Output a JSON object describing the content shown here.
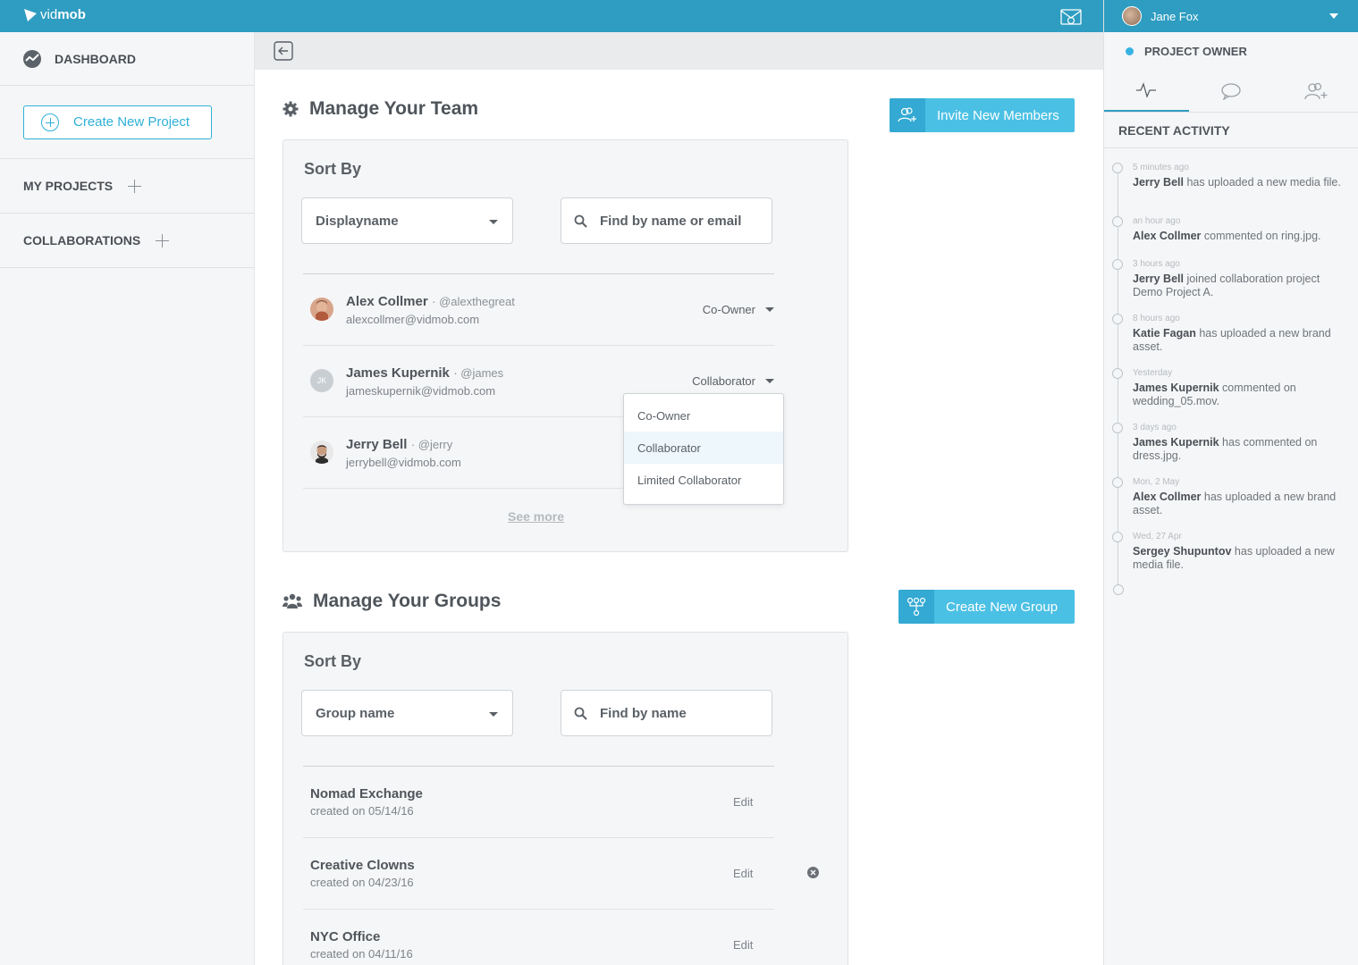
{
  "brand": {
    "name_light": "vid",
    "name_bold": "mob"
  },
  "user": {
    "name": "Jane Fox",
    "role": "PROJECT OWNER"
  },
  "sidebar": {
    "dashboard": "DASHBOARD",
    "create_project": "Create New Project",
    "my_projects": "MY PROJECTS",
    "collaborations": "COLLABORATIONS"
  },
  "team": {
    "title": "Manage Your Team",
    "invite_button": "Invite New Members",
    "sort_by": "Sort By",
    "sort_select": "Displayname",
    "search_placeholder": "Find by name or email",
    "members": [
      {
        "name": "Alex Collmer",
        "handle": "· @alexthegreat",
        "email": "alexcollmer@vidmob.com",
        "role": "Co-Owner"
      },
      {
        "name": "James Kupernik",
        "handle": "· @james",
        "email": "jameskupernik@vidmob.com",
        "role": "Collaborator",
        "initials": "JK"
      },
      {
        "name": "Jerry Bell",
        "handle": "· @jerry",
        "email": "jerrybell@vidmob.com",
        "role": ""
      }
    ],
    "see_more": "See more",
    "role_options": [
      "Co-Owner",
      "Collaborator",
      "Limited Collaborator"
    ],
    "selected_role_option": "Collaborator"
  },
  "groups": {
    "title": "Manage Your Groups",
    "create_button": "Create New Group",
    "sort_by": "Sort By",
    "sort_select": "Group name",
    "search_placeholder": "Find by name",
    "items": [
      {
        "name": "Nomad Exchange",
        "created": "created on 05/14/16",
        "action": "Edit"
      },
      {
        "name": "Creative Clowns",
        "created": "created on 04/23/16",
        "action": "Edit"
      },
      {
        "name": "NYC Office",
        "created": "created on 04/11/16",
        "action": "Edit"
      }
    ]
  },
  "activity": {
    "title": "RECENT ACTIVITY",
    "items": [
      {
        "time": "5 minutes ago",
        "who": "Jerry Bell",
        "text": " has uploaded a new media file."
      },
      {
        "time": "an hour ago",
        "who": "Alex Collmer",
        "text": " commented on ring.jpg."
      },
      {
        "time": "3 hours ago",
        "who": "Jerry Bell",
        "text": " joined collaboration project Demo Project A."
      },
      {
        "time": "8 hours ago",
        "who": "Katie Fagan",
        "text": " has uploaded a new brand asset."
      },
      {
        "time": "Yesterday",
        "who": "James Kupernik",
        "text": " commented on wedding_05.mov."
      },
      {
        "time": "3 days ago",
        "who": "James Kupernik",
        "text": " has commented on dress.jpg."
      },
      {
        "time": "Mon, 2 May",
        "who": "Alex Collmer",
        "text": " has uploaded a new brand asset."
      },
      {
        "time": "Wed, 27 Apr",
        "who": "Sergey Shupuntov",
        "text": " has uploaded a new media file."
      }
    ]
  },
  "colors": {
    "brand": "#2e9dc1",
    "accent": "#4bc0e5",
    "status_dot": "#37b3e3"
  }
}
